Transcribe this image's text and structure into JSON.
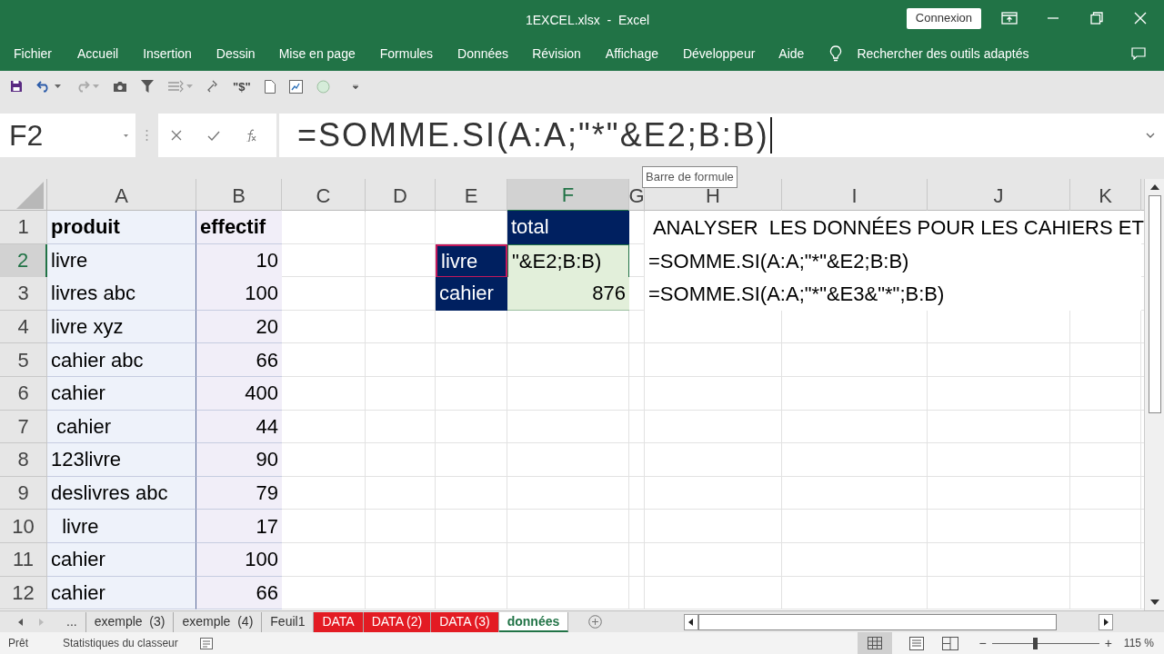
{
  "window": {
    "title": "1EXCEL.xlsx  -  Excel",
    "sign_in": "Connexion"
  },
  "ribbon_tabs": [
    "Fichier",
    "Accueil",
    "Insertion",
    "Dessin",
    "Mise en page",
    "Formules",
    "Données",
    "Révision",
    "Affichage",
    "Développeur",
    "Aide"
  ],
  "tell_me": "Rechercher des outils adaptés",
  "quick_access": {
    "currency_label": "\"$\""
  },
  "formula_bar": {
    "name_box": "F2",
    "formula": "=SOMME.SI(A:A;\"*\"&E2;B:B)",
    "tooltip": "Barre de formule"
  },
  "columns": [
    {
      "letter": "A",
      "selected": false
    },
    {
      "letter": "B",
      "selected": false
    },
    {
      "letter": "C",
      "selected": false
    },
    {
      "letter": "D",
      "selected": false
    },
    {
      "letter": "E",
      "selected": false
    },
    {
      "letter": "F",
      "selected": true
    },
    {
      "letter": "G",
      "selected": false
    },
    {
      "letter": "H",
      "selected": false
    },
    {
      "letter": "I",
      "selected": false
    },
    {
      "letter": "J",
      "selected": false
    },
    {
      "letter": "K",
      "selected": false
    }
  ],
  "rows": [
    {
      "number": "1",
      "selected": false,
      "column_a": {
        "kind": "header",
        "text": "produit"
      },
      "column_b": {
        "kind": "header",
        "text": "effectif"
      },
      "column_f": {
        "kind": "label",
        "text": "total"
      },
      "column_h": {
        "kind": "plain",
        "text": " ANALYSER  LES DONNÉES POUR LES CAHIERS ET"
      }
    },
    {
      "number": "2",
      "selected": true,
      "column_a": {
        "kind": "text",
        "text": "livre"
      },
      "column_b": {
        "kind": "number",
        "text": "10"
      },
      "column_e": {
        "kind": "label",
        "text": "livre",
        "selected": true
      },
      "column_f": {
        "kind": "editing",
        "text": "\"&E2;B:B)"
      },
      "column_h": {
        "kind": "plain",
        "text": "=SOMME.SI(A:A;\"*\"&E2;B:B)"
      }
    },
    {
      "number": "3",
      "selected": false,
      "column_a": {
        "kind": "text",
        "text": "livres abc"
      },
      "column_b": {
        "kind": "number",
        "text": "100"
      },
      "column_e": {
        "kind": "label",
        "text": "cahier",
        "selected": false
      },
      "column_f": {
        "kind": "total",
        "text": "876"
      },
      "column_h": {
        "kind": "plain",
        "text": "=SOMME.SI(A:A;\"*\"&E3&\"*\";B:B)"
      }
    },
    {
      "number": "4",
      "selected": false,
      "column_a": {
        "kind": "text",
        "text": "livre xyz"
      },
      "column_b": {
        "kind": "number",
        "text": "20"
      }
    },
    {
      "number": "5",
      "selected": false,
      "column_a": {
        "kind": "text",
        "text": "cahier abc"
      },
      "column_b": {
        "kind": "number",
        "text": "66"
      }
    },
    {
      "number": "6",
      "selected": false,
      "column_a": {
        "kind": "text",
        "text": "cahier"
      },
      "column_b": {
        "kind": "number",
        "text": "400"
      }
    },
    {
      "number": "7",
      "selected": false,
      "column_a": {
        "kind": "text",
        "text": " cahier"
      },
      "column_b": {
        "kind": "number",
        "text": "44"
      }
    },
    {
      "number": "8",
      "selected": false,
      "column_a": {
        "kind": "text",
        "text": "123livre"
      },
      "column_b": {
        "kind": "number",
        "text": "90"
      }
    },
    {
      "number": "9",
      "selected": false,
      "column_a": {
        "kind": "text",
        "text": "deslivres abc"
      },
      "column_b": {
        "kind": "number",
        "text": "79"
      }
    },
    {
      "number": "10",
      "selected": false,
      "column_a": {
        "kind": "text",
        "text": "  livre"
      },
      "column_b": {
        "kind": "number",
        "text": "17"
      }
    },
    {
      "number": "11",
      "selected": false,
      "column_a": {
        "kind": "text",
        "text": "cahier"
      },
      "column_b": {
        "kind": "number",
        "text": "100"
      }
    },
    {
      "number": "12",
      "selected": false,
      "column_a": {
        "kind": "text",
        "text": "cahier"
      },
      "column_b": {
        "kind": "number",
        "text": "66"
      }
    }
  ],
  "sheet_tabs": [
    {
      "label": "...",
      "selected": false
    },
    {
      "label": "exemple  (3)",
      "selected": false
    },
    {
      "label": "exemple  (4)",
      "selected": false
    },
    {
      "label": "Feuil1",
      "selected": false
    },
    {
      "label": "DATA",
      "selected": false,
      "color": "#e31b23"
    },
    {
      "label": "DATA (2)",
      "selected": false,
      "color": "#e31b23"
    },
    {
      "label": "DATA (3)",
      "selected": false,
      "color": "#e31b23"
    },
    {
      "label": "données",
      "selected": true
    }
  ],
  "status_bar": {
    "mode": "Prêt",
    "stats": "Statistiques du classeur",
    "zoom_minus": "−",
    "zoom_plus": "+",
    "zoom": {
      "level": 0.4
    },
    "zoom_label": "115 %"
  }
}
